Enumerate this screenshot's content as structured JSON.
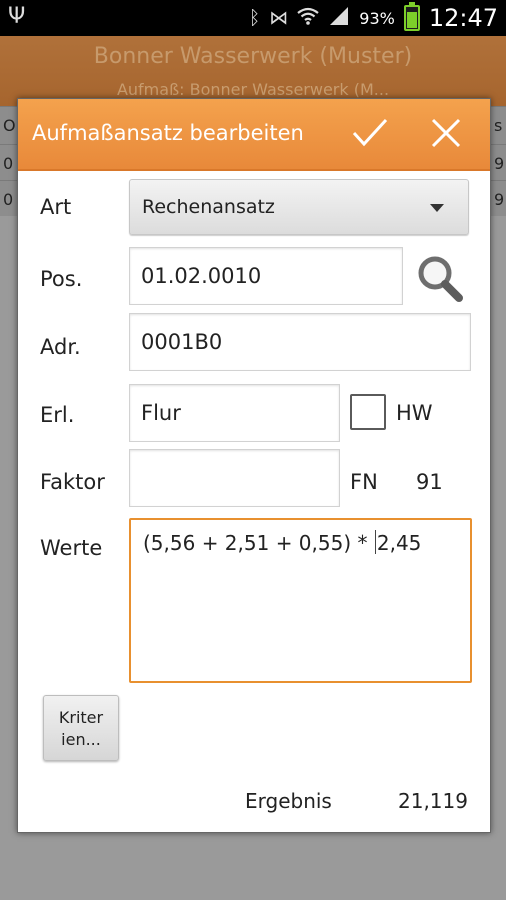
{
  "status_bar": {
    "battery_percent": "93%",
    "time": "12:47"
  },
  "background": {
    "title": "Bonner Wasserwerk (Muster)",
    "subtitle": "Aufmaß: Bonner Wasserwerk (M...",
    "row_left_glyphs": [
      "O",
      "0",
      "0"
    ],
    "row_right_glyphs": [
      "s",
      "9",
      "9"
    ]
  },
  "dialog": {
    "title": "Aufmaßansatz bearbeiten",
    "art_label": "Art",
    "art_value": "Rechenansatz",
    "pos_label": "Pos.",
    "pos_value": "01.02.0010",
    "adr_label": "Adr.",
    "adr_value": "0001B0",
    "erl_label": "Erl.",
    "erl_value": "Flur",
    "hw_label": "HW",
    "hw_checked": false,
    "faktor_label": "Faktor",
    "faktor_value": "",
    "fn_label": "FN",
    "fn_value": "91",
    "werte_label": "Werte",
    "werte_before_caret": "(5,56 + 2,51 + 0,55) * ",
    "werte_after_caret": "2,45",
    "kriterien_line1": "Kriter",
    "kriterien_line2": "ien...",
    "ergebnis_label": "Ergebnis",
    "ergebnis_value": "21,119"
  },
  "colors": {
    "accent": "#e8893a",
    "focus_border": "#e8902f"
  }
}
